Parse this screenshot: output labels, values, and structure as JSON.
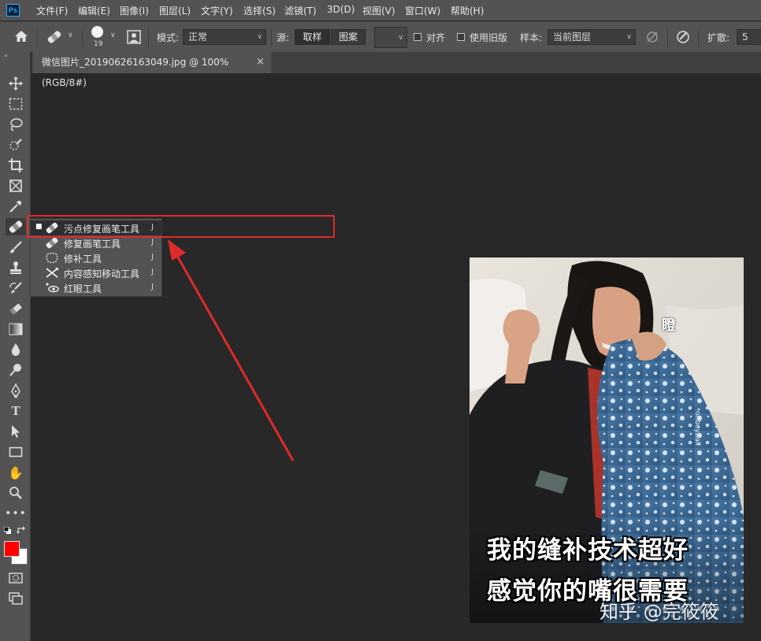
{
  "app": {
    "logo": "Ps"
  },
  "menu": [
    "文件(F)",
    "编辑(E)",
    "图像(I)",
    "图层(L)",
    "文字(Y)",
    "选择(S)",
    "滤镜(T)",
    "3D(D)",
    "视图(V)",
    "窗口(W)",
    "帮助(H)"
  ],
  "options": {
    "brush_size": "19",
    "mode_label": "模式:",
    "mode_value": "正常",
    "source_label": "源:",
    "source_sampled": "取样",
    "source_pattern": "图案",
    "aligned_label": "对齐",
    "legacy_label": "使用旧版",
    "sample_label": "样本:",
    "sample_value": "当前图层",
    "diffusion_label": "扩散:",
    "diffusion_value": "5"
  },
  "document": {
    "tab_title": "微信图片_20190626163049.jpg @ 100%(RGB/8#)",
    "close": "×"
  },
  "flyout": {
    "items": [
      {
        "label": "污点修复画笔工具",
        "shortcut": "J",
        "icon": "spot-healing-brush-icon",
        "active": true
      },
      {
        "label": "修复画笔工具",
        "shortcut": "J",
        "icon": "healing-brush-icon"
      },
      {
        "label": "修补工具",
        "shortcut": "J",
        "icon": "patch-icon"
      },
      {
        "label": "内容感知移动工具",
        "shortcut": "J",
        "icon": "content-aware-move-icon"
      },
      {
        "label": "红眼工具",
        "shortcut": "J",
        "icon": "red-eye-icon"
      }
    ]
  },
  "colors": {
    "foreground": "#ff0000",
    "background": "#ffffff",
    "highlight": "#e02a2a"
  },
  "image": {
    "stamp": "瞪",
    "caption_line1": "我的缝补技术超好",
    "caption_line2": "感觉你的嘴很需要",
    "watermark": "知乎 @完筱筱",
    "side_text": "ohboyball"
  }
}
